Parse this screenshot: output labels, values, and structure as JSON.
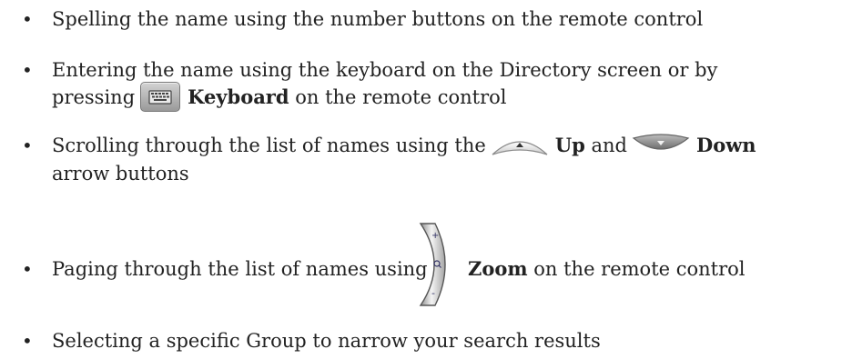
{
  "bullets": {
    "symbol": "•",
    "b1": {
      "text": "Spelling the name using the number buttons on the remote control"
    },
    "b2": {
      "line1": "Entering the name using the keyboard on the Directory screen or by",
      "pressing": "pressing",
      "keyboard_icon": "keyboard-button-icon",
      "keyboard_bold": "Keyboard",
      "suffix": "on the remote control"
    },
    "b3": {
      "prefix": "Scrolling through the list of names using the",
      "up_icon": "up-arrow-button-icon",
      "up_bold": "Up",
      "and": "and",
      "down_icon": "down-arrow-button-icon",
      "down_bold": "Down",
      "line2": "arrow buttons"
    },
    "b4": {
      "prefix": "Paging through the list of names using",
      "zoom_icon": "zoom-rocker-icon",
      "zoom_bold": "Zoom",
      "suffix": "on the remote control"
    },
    "b5": {
      "text": "Selecting a specific Group to narrow your search results"
    }
  }
}
